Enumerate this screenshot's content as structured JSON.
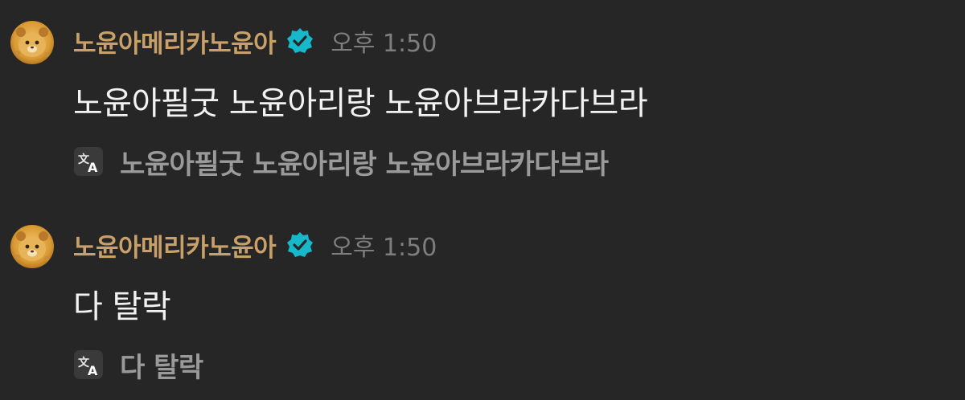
{
  "messages": [
    {
      "username": "노윤아메리카노윤아",
      "time": "오후 1:50",
      "text": "노윤아필굿 노윤아리랑 노윤아브라카다브라",
      "translation": "노윤아필굿 노윤아리랑 노윤아브라카다브라"
    },
    {
      "username": "노윤아메리카노윤아",
      "time": "오후 1:50",
      "text": "다 탈락",
      "translation": "다 탈락"
    }
  ],
  "colors": {
    "background": "#262626",
    "username": "#c9a06a",
    "verified_badge": "#17b8c9",
    "timestamp": "#7e7e7e",
    "message_text": "#f2f2f2",
    "translation_text": "#9a9a9a"
  },
  "icons": {
    "verified": "verified-badge-icon",
    "translate": "translate-icon"
  }
}
